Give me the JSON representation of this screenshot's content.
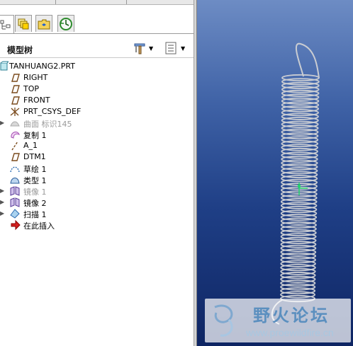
{
  "panel": {
    "title": "模型树",
    "tabs": [
      "model-tree-tab",
      "layer-tab",
      "folder-tab",
      "favorites-tab"
    ]
  },
  "tree": {
    "root": "TANHUANG2.PRT",
    "items": [
      {
        "label": "RIGHT",
        "icon": "datum-plane-icon",
        "expandable": false,
        "gray": false
      },
      {
        "label": "TOP",
        "icon": "datum-plane-icon",
        "expandable": false,
        "gray": false
      },
      {
        "label": "FRONT",
        "icon": "datum-plane-icon",
        "expandable": false,
        "gray": false
      },
      {
        "label": "PRT_CSYS_DEF",
        "icon": "coordinate-system-icon",
        "expandable": false,
        "gray": false
      },
      {
        "label": "曲面 标识145",
        "icon": "surface-icon",
        "expandable": true,
        "gray": true
      },
      {
        "label": "复制 1",
        "icon": "copy-icon",
        "expandable": false,
        "gray": false
      },
      {
        "label": "A_1",
        "icon": "datum-axis-icon",
        "expandable": false,
        "gray": false
      },
      {
        "label": "DTM1",
        "icon": "datum-plane-icon",
        "expandable": false,
        "gray": false
      },
      {
        "label": "草绘 1",
        "icon": "sketch-icon",
        "expandable": false,
        "gray": false
      },
      {
        "label": "类型 1",
        "icon": "thicken-icon",
        "expandable": false,
        "gray": false
      },
      {
        "label": "镜像 1",
        "icon": "mirror-icon",
        "expandable": true,
        "gray": true
      },
      {
        "label": "镜像 2",
        "icon": "mirror-icon",
        "expandable": true,
        "gray": false
      },
      {
        "label": "扫描 1",
        "icon": "sweep-icon",
        "expandable": true,
        "gray": false
      },
      {
        "label": "在此插入",
        "icon": "insert-here-arrow-icon",
        "expandable": false,
        "gray": false
      }
    ]
  },
  "watermark": {
    "title": "野火论坛",
    "url": "www.proewildfire.cn"
  },
  "colors": {
    "viewport_top": "#6d8cc4",
    "viewport_bottom": "#0e2563",
    "spring": "#c9ccd2",
    "csys_marker": "#22d26a"
  }
}
